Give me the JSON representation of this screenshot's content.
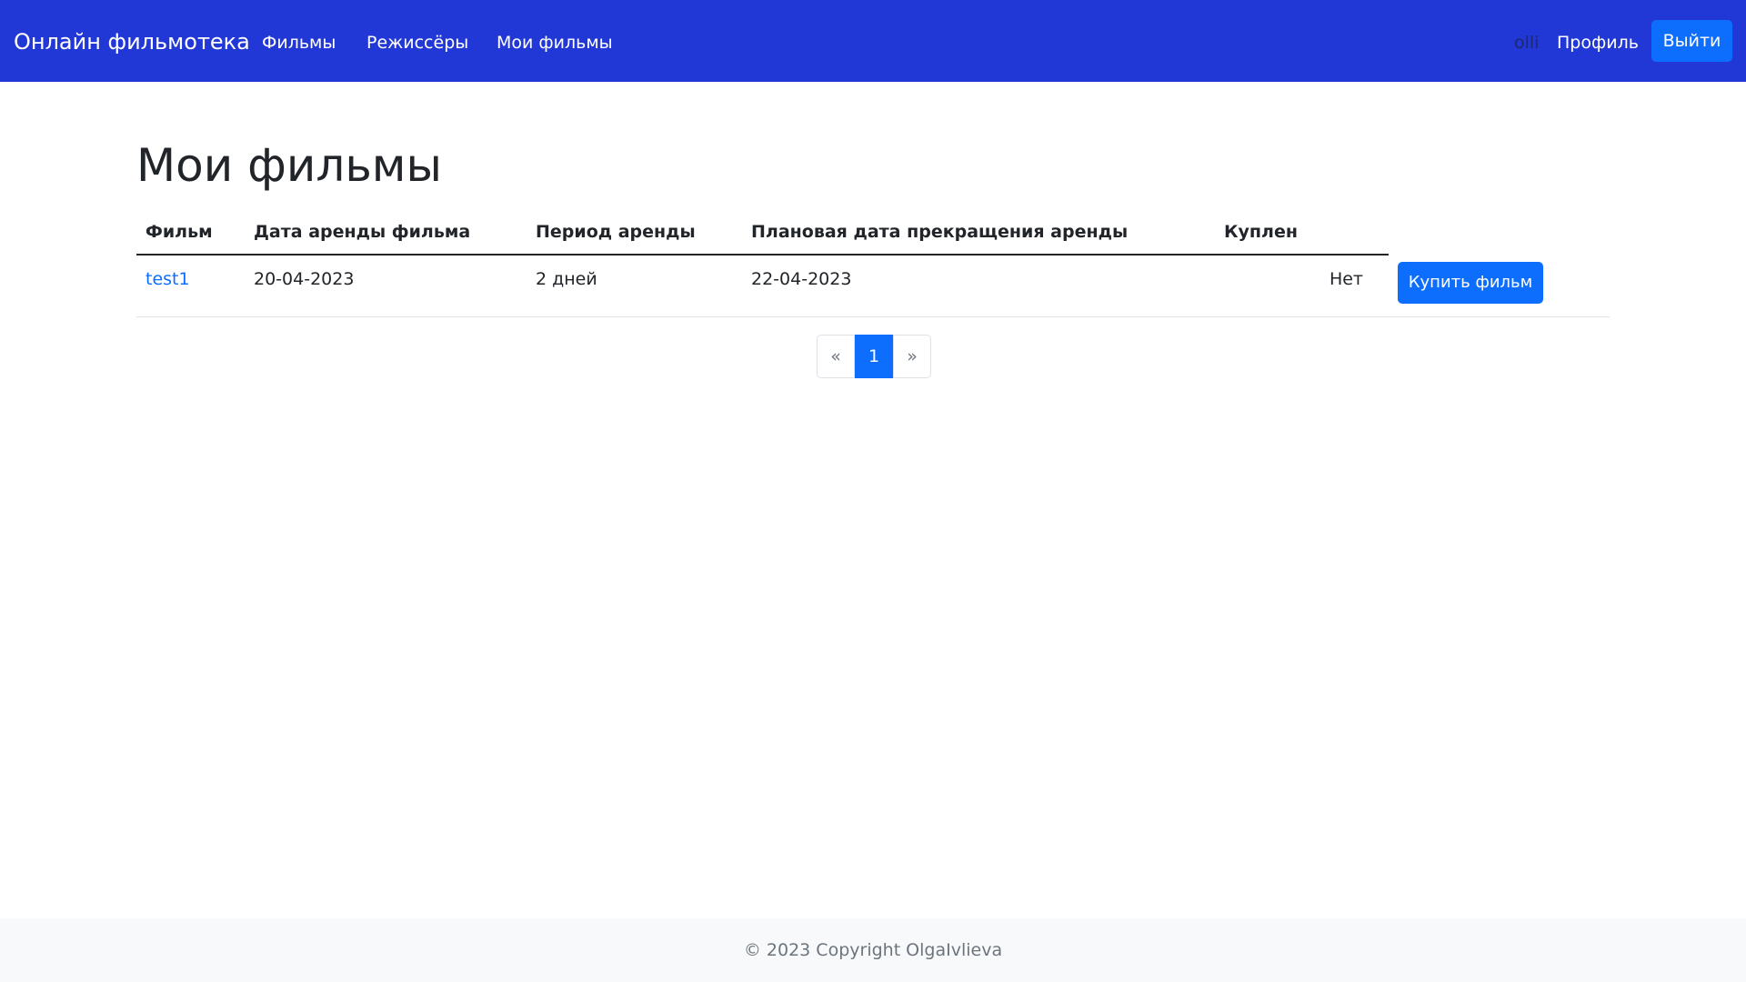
{
  "navbar": {
    "brand": "Онлайн фильмотека",
    "links": [
      {
        "label": "Фильмы"
      },
      {
        "label": "Режиссёры"
      },
      {
        "label": "Мои фильмы"
      }
    ],
    "username": "olli",
    "profile_label": "Профиль",
    "logout_label": "Выйти",
    "colors": {
      "background": "#2238d6",
      "button": "#0d6efd"
    }
  },
  "main": {
    "title": "Мои фильмы",
    "table": {
      "columns": [
        "Фильм",
        "Дата аренды фильма",
        "Период аренды",
        "Плановая дата прекращения аренды",
        "Куплен"
      ],
      "rows": [
        {
          "film": "test1",
          "rent_date": "20-04-2023",
          "period": "2 дней",
          "end_date": "22-04-2023",
          "bought": "Нет",
          "action_label": "Купить фильм"
        }
      ]
    },
    "pagination": {
      "prev": "«",
      "current": "1",
      "next": "»"
    }
  },
  "footer": {
    "text": "© 2023 Copyright OlgaIvlieva"
  }
}
